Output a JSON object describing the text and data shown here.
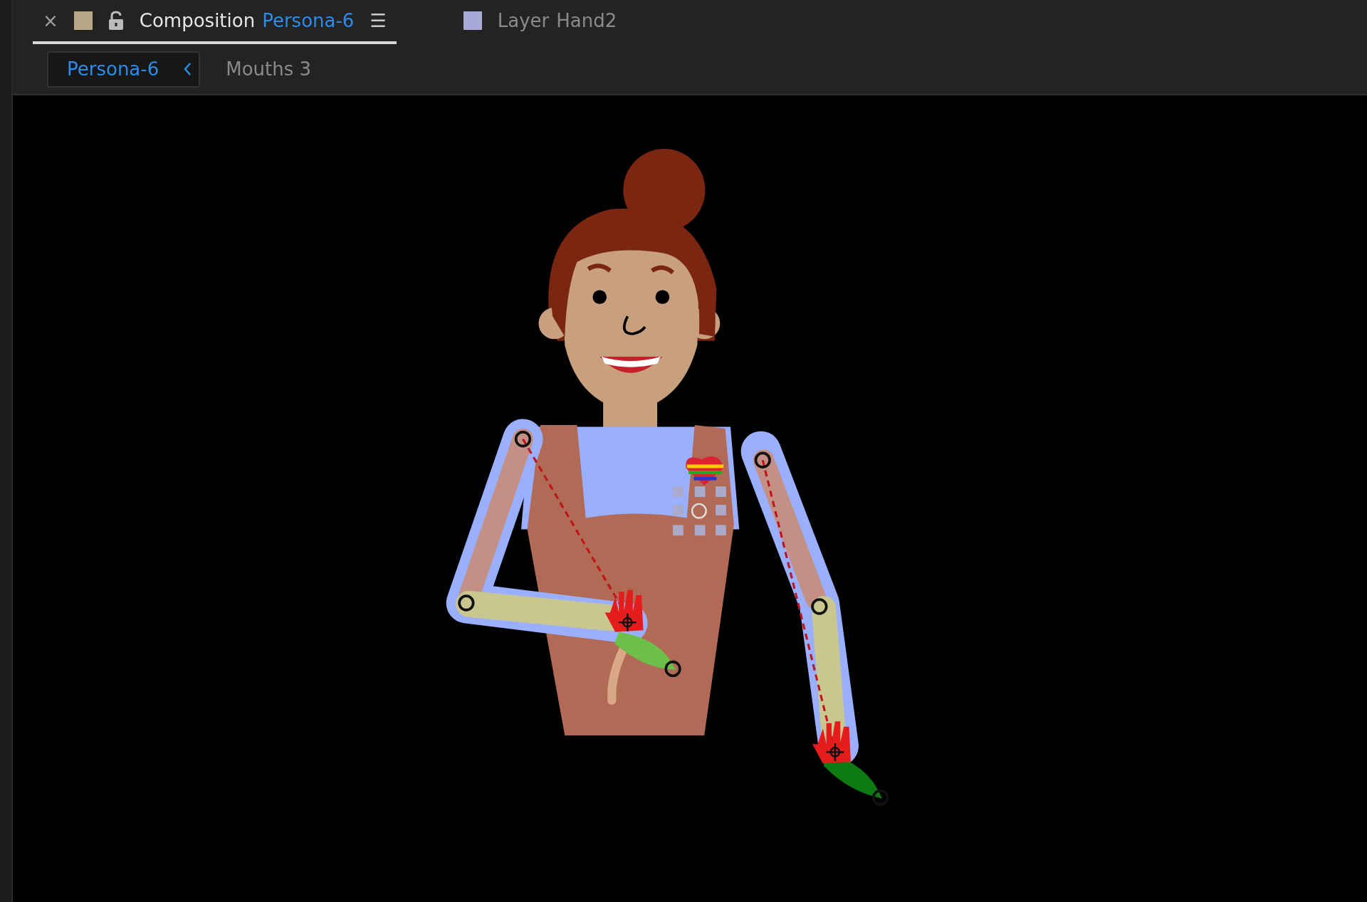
{
  "panel_tabs": [
    {
      "kind": "composition",
      "type_label": "Composition",
      "name": "Persona-6",
      "color": "#b8a888",
      "selected": true,
      "close": "×",
      "menu": "☰"
    },
    {
      "kind": "layer",
      "type_label": "Layer",
      "name": "Hand2",
      "color": "#a9a9d8",
      "selected": false
    }
  ],
  "breadcrumbs": [
    {
      "label": "Persona-6",
      "selected": true
    },
    {
      "label": "Mouths 3",
      "selected": false
    }
  ]
}
